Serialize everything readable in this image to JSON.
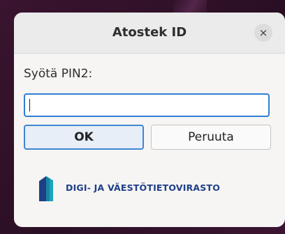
{
  "dialog": {
    "title": "Atostek ID",
    "close_icon": "close-icon",
    "close_glyph": "×",
    "pin_label": "Syötä PIN2:",
    "pin_value": "",
    "ok_label": "OK",
    "cancel_label": "Peruuta",
    "logo_text": "DIGI- JA VÄESTÖTIETOVIRASTO"
  },
  "colors": {
    "accent": "#3f86d2",
    "logo_primary": "#1e3f86",
    "logo_teal": "#19a7b8"
  }
}
